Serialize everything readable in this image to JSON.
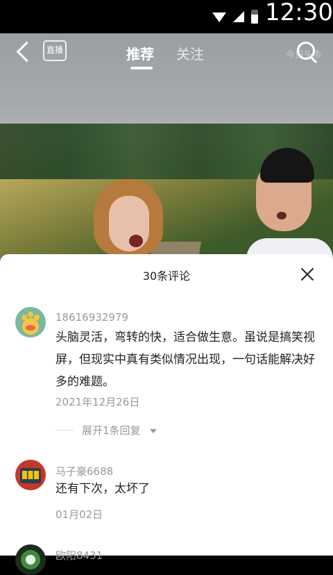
{
  "status_bar": {
    "time": "12:30"
  },
  "top_bar": {
    "live_label": "直播",
    "tabs": [
      "推荐",
      "关注"
    ],
    "watermark": "今日头条"
  },
  "comments_sheet": {
    "title": "30条评论",
    "comments": [
      {
        "username": "18616932979",
        "text": "头脑灵活，弯转的快，适合做生意。虽说是搞笑视屏，但现实中真有类似情况出现，一句话能解决好多的难题。",
        "date": "2021年12月26日",
        "reply_toggle": "展开1条回复"
      },
      {
        "username": "马子豪6688",
        "text": "还有下次，太坏了",
        "date": "01月02日"
      },
      {
        "username": "欧阳8431"
      }
    ]
  },
  "colors": {
    "secondary_text": "#999999",
    "primary_text": "#222222",
    "sheet_bg": "#ffffff"
  },
  "icons": [
    "wifi-icon",
    "signal-icon",
    "battery-icon",
    "back-icon",
    "live-icon",
    "search-icon",
    "close-icon",
    "chevron-down-icon"
  ]
}
